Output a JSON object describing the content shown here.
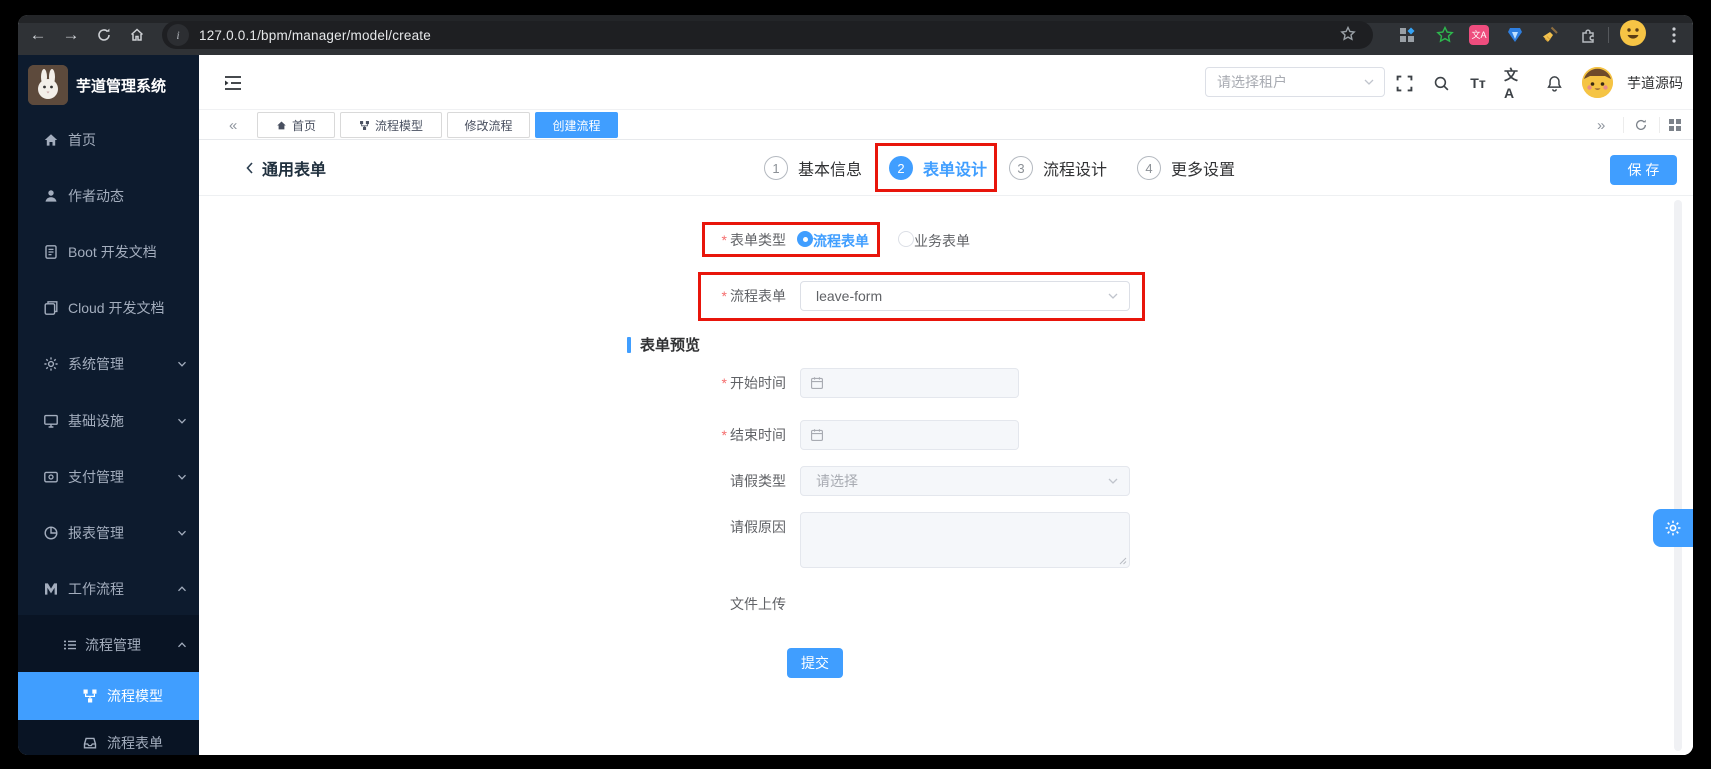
{
  "theme": {
    "accent": "#409eff",
    "annotation_red": "#e8150b",
    "sidebar_bg": "#0d1b2e"
  },
  "browser": {
    "url": "127.0.0.1/bpm/manager/model/create"
  },
  "sidebar": {
    "title": "芋道管理系统",
    "items": [
      {
        "label": "首页"
      },
      {
        "label": "作者动态"
      },
      {
        "label": "Boot 开发文档"
      },
      {
        "label": "Cloud 开发文档"
      },
      {
        "label": "系统管理"
      },
      {
        "label": "基础设施"
      },
      {
        "label": "支付管理"
      },
      {
        "label": "报表管理"
      },
      {
        "label": "工作流程"
      }
    ],
    "submenu": {
      "label": "流程管理",
      "children": [
        {
          "label": "流程模型"
        },
        {
          "label": "流程表单"
        }
      ]
    }
  },
  "header": {
    "tenant_placeholder": "请选择租户",
    "username": "芋道源码",
    "font_icon": "Tт",
    "locale_icon": "文A"
  },
  "tabbar": {
    "tabs": [
      {
        "label": "首页"
      },
      {
        "label": "流程模型"
      },
      {
        "label": "修改流程"
      },
      {
        "label": "创建流程"
      }
    ]
  },
  "page": {
    "title": "通用表单",
    "save_label": "保 存",
    "steps": [
      {
        "num": "1",
        "label": "基本信息"
      },
      {
        "num": "2",
        "label": "表单设计"
      },
      {
        "num": "3",
        "label": "流程设计"
      },
      {
        "num": "4",
        "label": "更多设置"
      }
    ]
  },
  "form": {
    "required_mark": "*",
    "form_type": {
      "label": "表单类型",
      "options": [
        {
          "label": "流程表单"
        },
        {
          "label": "业务表单"
        }
      ]
    },
    "process_form": {
      "label": "流程表单",
      "value": "leave-form"
    },
    "preview": {
      "title": "表单预览",
      "fields": [
        {
          "label": "开始时间"
        },
        {
          "label": "结束时间"
        },
        {
          "label": "请假类型",
          "placeholder": "请选择"
        },
        {
          "label": "请假原因"
        },
        {
          "label": "文件上传"
        }
      ],
      "submit_label": "提交"
    }
  }
}
